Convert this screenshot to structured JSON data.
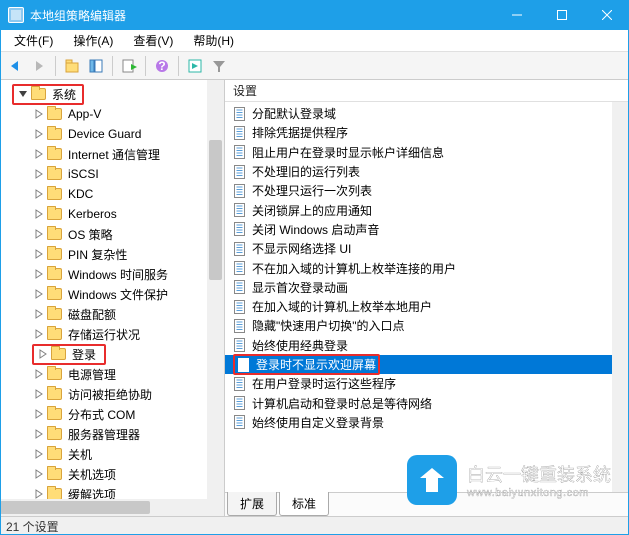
{
  "window_title": "本地组策略编辑器",
  "menubar": {
    "file": "文件(F)",
    "action": "操作(A)",
    "view": "查看(V)",
    "help": "帮助(H)"
  },
  "tree": {
    "root": "系统",
    "items": [
      "App-V",
      "Device Guard",
      "Internet 通信管理",
      "iSCSI",
      "KDC",
      "Kerberos",
      "OS 策略",
      "PIN 复杂性",
      "Windows 时间服务",
      "Windows 文件保护",
      "磁盘配额",
      "存储运行状况",
      "登录",
      "电源管理",
      "访问被拒绝协助",
      "分布式 COM",
      "服务器管理器",
      "关机",
      "关机选项",
      "缓解选项"
    ],
    "highlight_index": 12
  },
  "list": {
    "header": "设置",
    "items": [
      "分配默认登录域",
      "排除凭据提供程序",
      "阻止用户在登录时显示帐户详细信息",
      "不处理旧的运行列表",
      "不处理只运行一次列表",
      "关闭锁屏上的应用通知",
      "关闭 Windows 启动声音",
      "不显示网络选择 UI",
      "不在加入域的计算机上枚举连接的用户",
      "显示首次登录动画",
      "在加入域的计算机上枚举本地用户",
      "隐藏\"快速用户切换\"的入口点",
      "始终使用经典登录",
      "登录时不显示欢迎屏幕",
      "在用户登录时运行这些程序",
      "计算机启动和登录时总是等待网络",
      "始终使用自定义登录背景"
    ],
    "selected_index": 13
  },
  "tabs": {
    "extended": "扩展",
    "standard": "标准"
  },
  "statusbar": "21 个设置",
  "watermark": {
    "line1": "白云一键重装系统",
    "line2": "www.baiyunxitong.com"
  }
}
